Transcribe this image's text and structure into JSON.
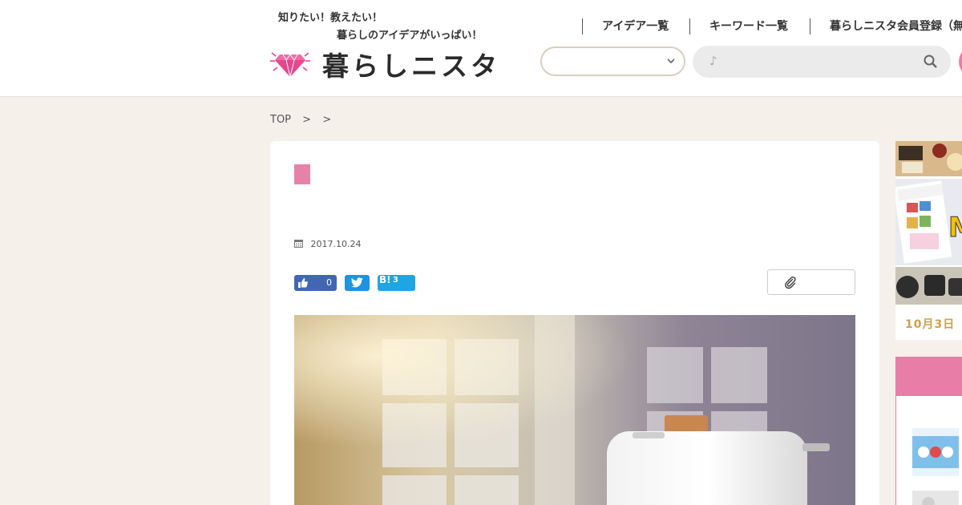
{
  "header": {
    "tagline_line1": "知りたい！教えたい！",
    "tagline_line2": "暮らしのアイデアがいっぱい！",
    "logo_text": "暮らしニスタ",
    "nav": [
      "アイデア一覧",
      "キーワード一覧",
      "暮らしニスタ会員登録（無"
    ],
    "search_placeholder": "♪"
  },
  "breadcrumb": [
    "TOP",
    ">",
    ">"
  ],
  "article": {
    "date": "2017.10.24",
    "like_count": "0",
    "hatena_label": "B!",
    "hatena_count": "3"
  },
  "sidebar": {
    "date_label": "10月3日"
  },
  "colors": {
    "accent_pink": "#e682aa",
    "background": "#f5f0ea",
    "facebook": "#4267b2",
    "twitter": "#1b95e0",
    "hatena": "#1ea5e2"
  }
}
